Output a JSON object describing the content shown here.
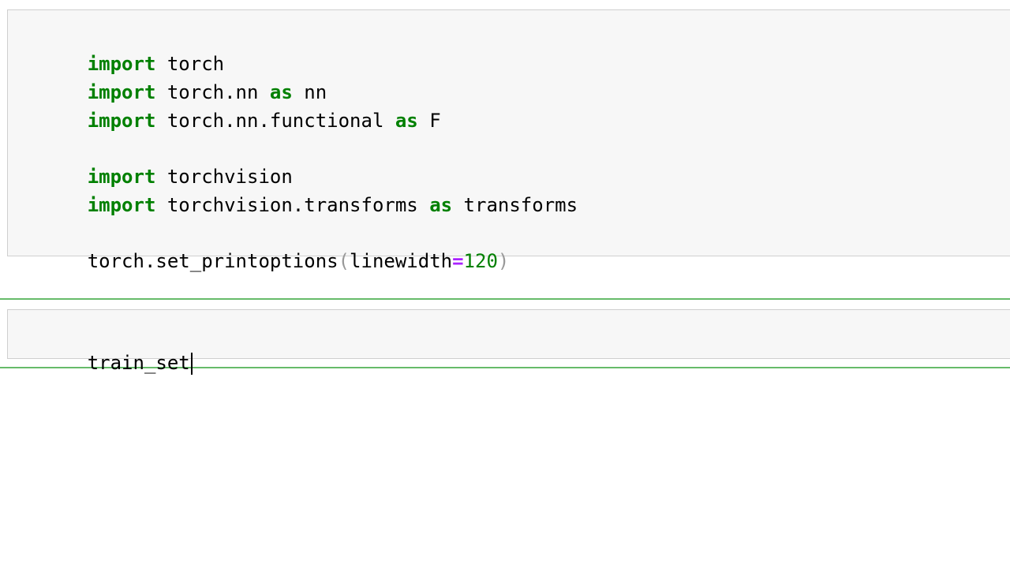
{
  "cells": [
    {
      "lines": [
        {
          "kw": "import",
          "rest": " torch"
        },
        {
          "kw": "import",
          "mid": " torch.nn ",
          "kw2": "as",
          "rest": " nn"
        },
        {
          "kw": "import",
          "mid": " torch.nn.functional ",
          "kw2": "as",
          "rest": " F"
        },
        {
          "kw": "import",
          "rest": " torchvision"
        },
        {
          "kw": "import",
          "mid": " torchvision.transforms ",
          "kw2": "as",
          "rest": " transforms"
        },
        {
          "func": "torch.set_printoptions",
          "open": "(",
          "arg": "linewidth",
          "eq": "=",
          "num": "120",
          "close": ")"
        }
      ]
    },
    {
      "text": "train_set"
    }
  ]
}
